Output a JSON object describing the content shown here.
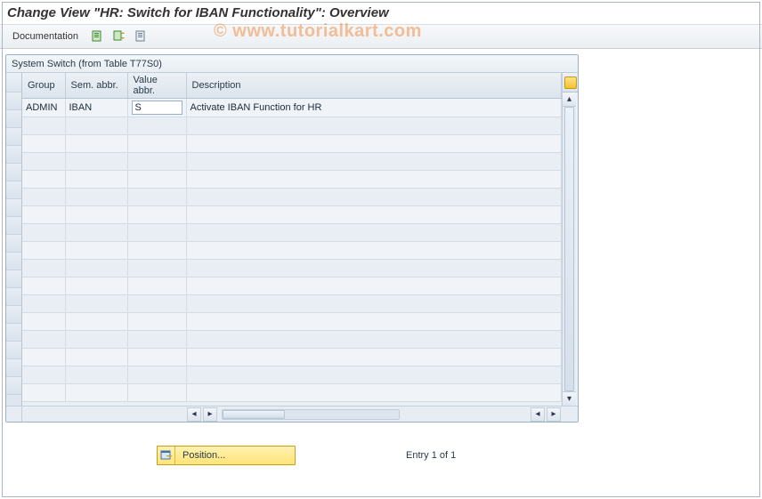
{
  "page": {
    "title": "Change View \"HR: Switch for IBAN Functionality\": Overview"
  },
  "toolbar": {
    "documentation_label": "Documentation"
  },
  "watermark": "© www.tutorialkart.com",
  "table": {
    "title": "System Switch (from Table T77S0)",
    "columns": {
      "group": "Group",
      "sem_abbr": "Sem. abbr.",
      "value_abbr": "Value abbr.",
      "description": "Description"
    },
    "rows": [
      {
        "group": "ADMIN",
        "sem_abbr": "IBAN",
        "value_abbr": "S",
        "description": "Activate IBAN Function for HR"
      }
    ]
  },
  "footer": {
    "position_label": "Position...",
    "entry_text": "Entry 1 of 1"
  }
}
